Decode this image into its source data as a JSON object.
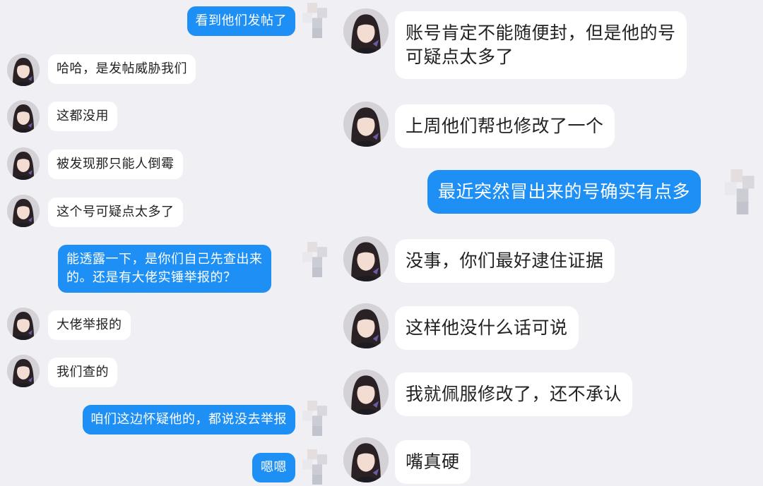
{
  "left_chat": {
    "messages": [
      {
        "side": "me",
        "text": "看到他们发帖了"
      },
      {
        "side": "other",
        "text": "哈哈，是发帖威胁我们"
      },
      {
        "side": "other",
        "text": "这都没用"
      },
      {
        "side": "other",
        "text": "被发现那只能人倒霉"
      },
      {
        "side": "other",
        "text": "这个号可疑点太多了"
      },
      {
        "side": "me",
        "lines": [
          "能透露一下，是你们自己先查出来",
          "的。还是有大佬实锤举报的？"
        ]
      },
      {
        "side": "other",
        "text": "大佬举报的"
      },
      {
        "side": "other",
        "text": "我们查的"
      },
      {
        "side": "me",
        "text": "咱们这边怀疑他的，都说没去举报"
      },
      {
        "side": "me",
        "text": "嗯嗯"
      }
    ]
  },
  "right_chat": {
    "messages": [
      {
        "side": "other",
        "lines": [
          "账号肯定不能随便封，但是他的号",
          "可疑点太多了"
        ]
      },
      {
        "side": "other",
        "text": "上周他们帮也修改了一个"
      },
      {
        "side": "me",
        "text": "最近突然冒出来的号确实有点多"
      },
      {
        "side": "other",
        "text": "没事，你们最好逮住证据"
      },
      {
        "side": "other",
        "text": "这样他没什么话可说"
      },
      {
        "side": "other",
        "text": "我就佩服修改了，还不承认"
      },
      {
        "side": "other",
        "text": "嘴真硬"
      }
    ]
  },
  "colors": {
    "background": "#efeff4",
    "incoming_bubble": "#ffffff",
    "outgoing_bubble": "#1d8ff5"
  },
  "icons": {
    "other_avatar": "user-avatar-icon",
    "self_avatar": "pixelated-avatar-icon"
  }
}
